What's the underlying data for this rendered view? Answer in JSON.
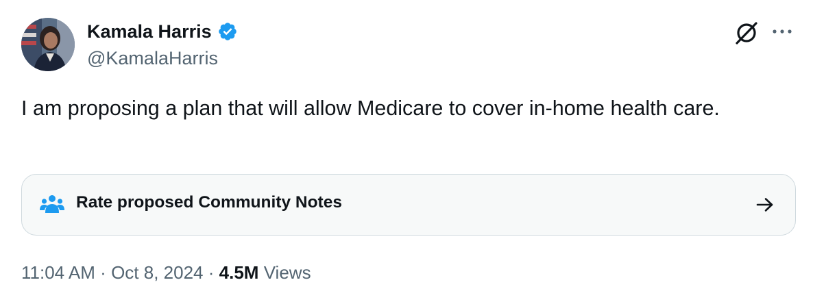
{
  "author": {
    "display_name": "Kamala Harris",
    "handle": "@KamalaHarris",
    "verified": true,
    "verified_badge_color": "#1d9bf0"
  },
  "tweet": {
    "text": "I am proposing a plan that will allow Medicare to cover in-home health care."
  },
  "community_notes": {
    "label": "Rate proposed Community Notes",
    "icon": "people-icon",
    "icon_color": "#1d9bf0",
    "arrow_icon": "arrow-right-icon"
  },
  "meta": {
    "time": "11:04 AM",
    "separator": "·",
    "date": "Oct 8, 2024",
    "views_count": "4.5M",
    "views_label": "Views"
  },
  "actions": {
    "grok_icon": "grok-icon",
    "more_icon": "more-horizontal-icon"
  },
  "colors": {
    "text_primary": "#0f1419",
    "text_secondary": "#536471",
    "card_background": "#f7f9f9",
    "card_border": "#cfd9de"
  }
}
